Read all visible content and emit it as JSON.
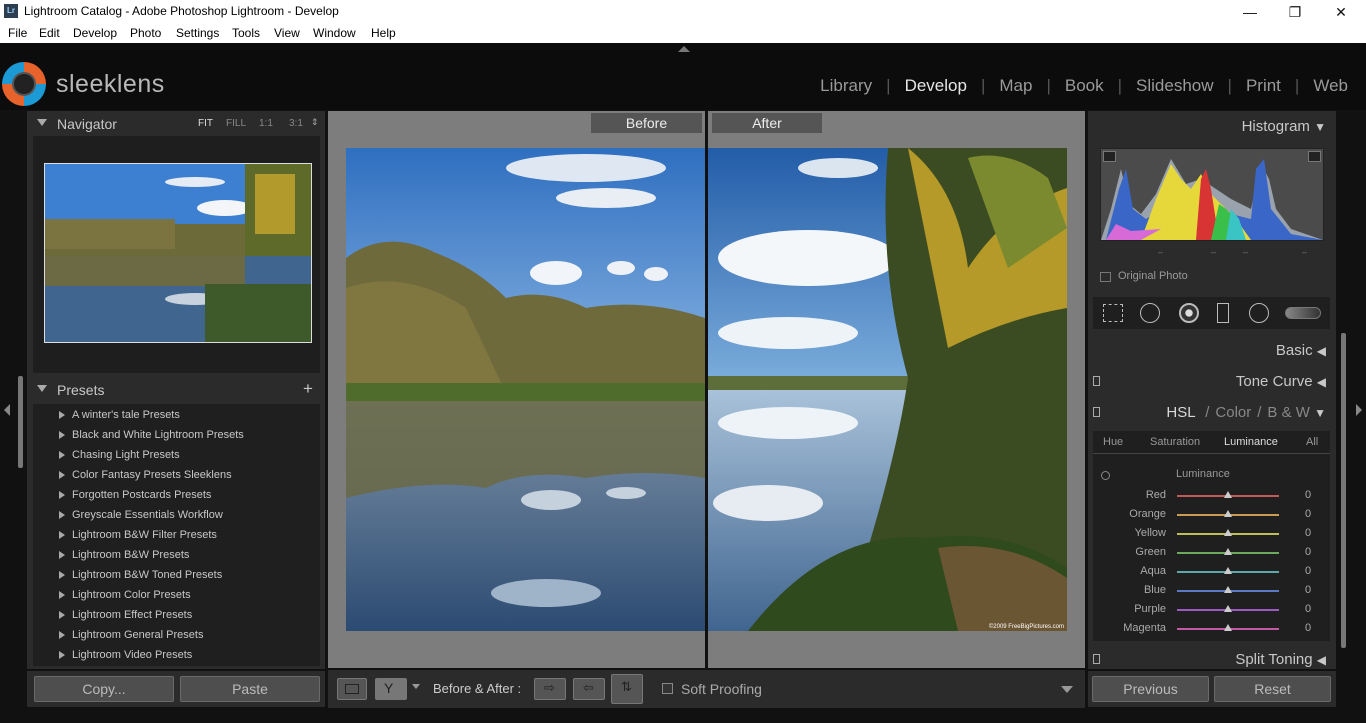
{
  "window": {
    "title": "Lightroom Catalog - Adobe Photoshop Lightroom - Develop",
    "app_icon": "Lr"
  },
  "menu": [
    "File",
    "Edit",
    "Develop",
    "Photo",
    "Settings",
    "Tools",
    "View",
    "Window",
    "Help"
  ],
  "brand": "sleeklens",
  "modules": [
    "Library",
    "Develop",
    "Map",
    "Book",
    "Slideshow",
    "Print",
    "Web"
  ],
  "active_module": "Develop",
  "navigator": {
    "title": "Navigator",
    "zoom_fit": "FIT",
    "zoom_fill": "FILL",
    "zoom_1": "1:1",
    "zoom_3": "3:1"
  },
  "presets": {
    "title": "Presets",
    "add": "+",
    "items": [
      "A winter's tale Presets",
      "Black and White Lightroom Presets",
      "Chasing Light Presets",
      "Color Fantasy Presets Sleeklens",
      "Forgotten Postcards Presets",
      "Greyscale Essentials Workflow",
      "Lightroom B&W Filter Presets",
      "Lightroom B&W Presets",
      "Lightroom B&W Toned Presets",
      "Lightroom Color Presets",
      "Lightroom Effect Presets",
      "Lightroom General Presets",
      "Lightroom Video Presets"
    ]
  },
  "left_buttons": {
    "copy": "Copy...",
    "paste": "Paste"
  },
  "view": {
    "before": "Before",
    "after": "After",
    "watermark": "©2009 FreeBigPictures.com"
  },
  "toolbar": {
    "before_after_label": "Before & After :",
    "soft_proofing": "Soft Proofing"
  },
  "right": {
    "histogram": "Histogram",
    "original_photo": "Original Photo",
    "histogram_readout": [
      "–",
      "–",
      "–",
      "–"
    ],
    "basic": "Basic",
    "tone_curve": "Tone Curve",
    "hsl": "HSL",
    "color": "Color",
    "bw": "B & W",
    "slash": "/",
    "tabs": [
      "Hue",
      "Saturation",
      "Luminance",
      "All"
    ],
    "active_tab": "Luminance",
    "luminance_title": "Luminance",
    "sliders": [
      {
        "label": "Red",
        "value": "0",
        "color": "#c25a5a"
      },
      {
        "label": "Orange",
        "value": "0",
        "color": "#c99b57"
      },
      {
        "label": "Yellow",
        "value": "0",
        "color": "#bdbd5a"
      },
      {
        "label": "Green",
        "value": "0",
        "color": "#6aaa5a"
      },
      {
        "label": "Aqua",
        "value": "0",
        "color": "#5aaaaa"
      },
      {
        "label": "Blue",
        "value": "0",
        "color": "#5a7ac2"
      },
      {
        "label": "Purple",
        "value": "0",
        "color": "#9a5ac2"
      },
      {
        "label": "Magenta",
        "value": "0",
        "color": "#c25aa8"
      }
    ],
    "split_toning": "Split Toning"
  },
  "right_buttons": {
    "previous": "Previous",
    "reset": "Reset"
  }
}
